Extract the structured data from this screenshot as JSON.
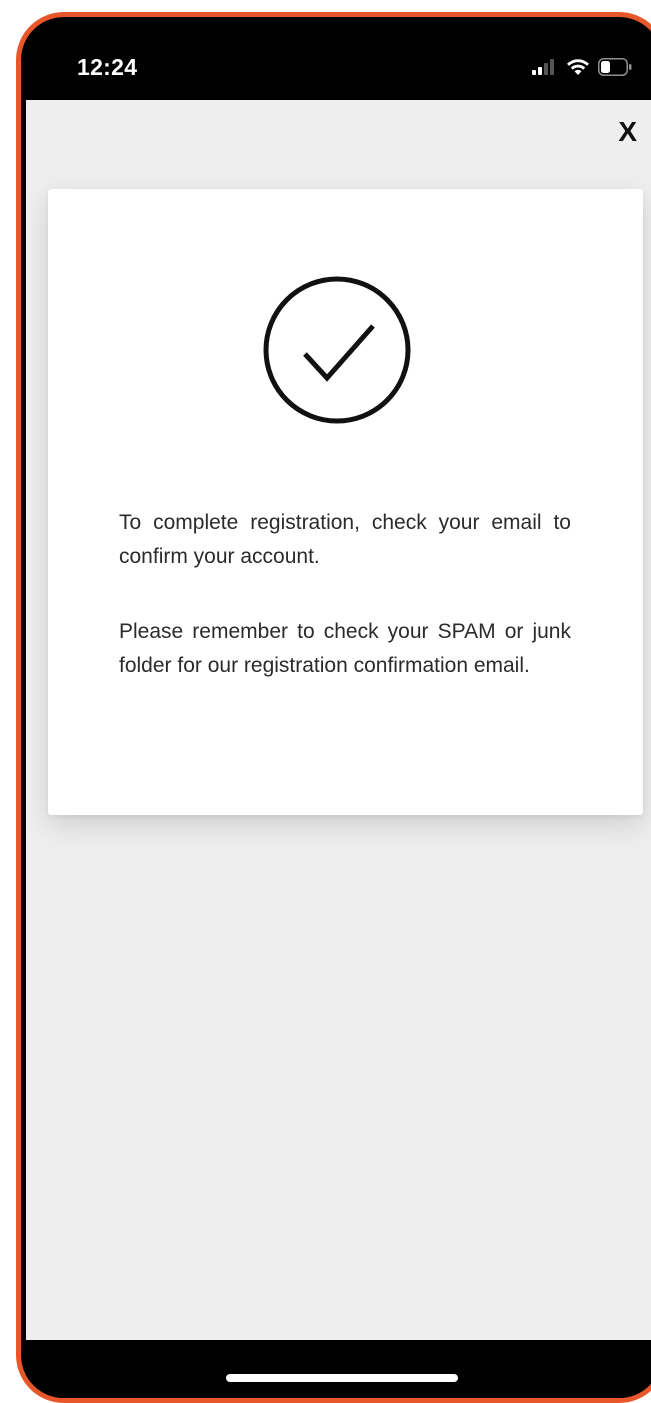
{
  "status_bar": {
    "time": "12:24",
    "icons": [
      "cellular-signal-icon",
      "wifi-icon",
      "battery-icon"
    ]
  },
  "modal": {
    "close_label": "X",
    "icon": "check-circle-icon",
    "message_primary": "To complete registration, check your email to confirm your account.",
    "message_secondary": "Please remember to check your SPAM or junk folder for our registration confirmation email."
  },
  "colors": {
    "frame_accent": "#e8572a",
    "background": "#eeeeee",
    "card": "#ffffff",
    "text": "#2b2b2b"
  }
}
